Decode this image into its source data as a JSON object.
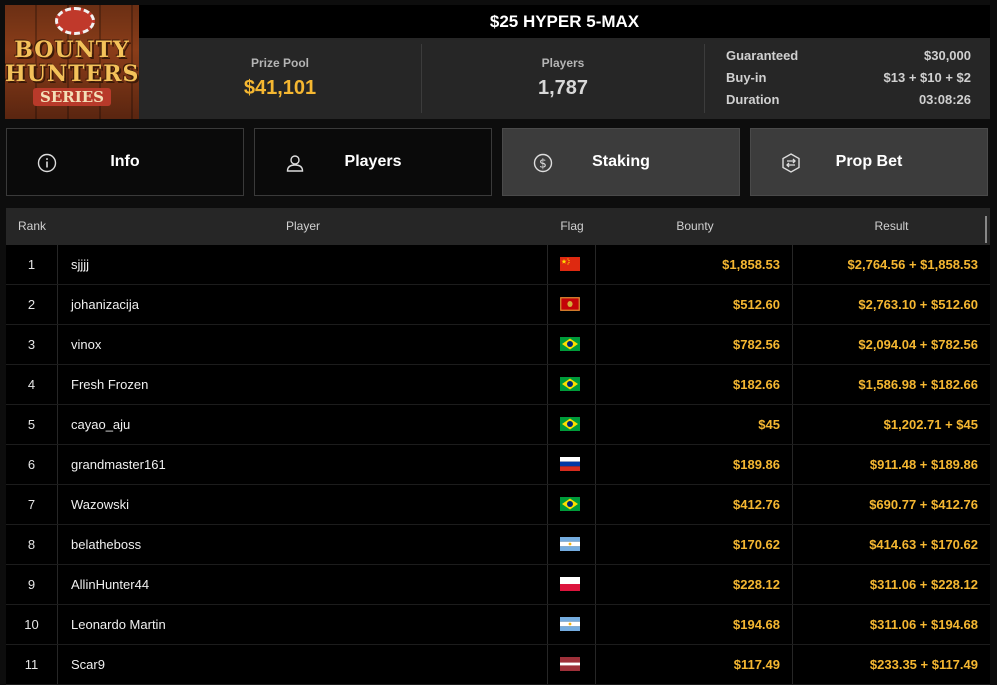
{
  "logo": {
    "line1": "BOUNTY",
    "line2": "HUNTERS",
    "line3": "SERIES"
  },
  "title": "$25 HYPER 5-MAX",
  "stats": {
    "prize_pool_label": "Prize Pool",
    "prize_pool_value": "$41,101",
    "players_label": "Players",
    "players_value": "1,787"
  },
  "details": [
    {
      "label": "Guaranteed",
      "value": "$30,000"
    },
    {
      "label": "Buy-in",
      "value": "$13 + $10 + $2"
    },
    {
      "label": "Duration",
      "value": "03:08:26"
    }
  ],
  "tabs": [
    {
      "label": "Info",
      "icon": "info-icon",
      "active": false
    },
    {
      "label": "Players",
      "icon": "user-icon",
      "active": false
    },
    {
      "label": "Staking",
      "icon": "dollar-coin-icon",
      "active": true
    },
    {
      "label": "Prop Bet",
      "icon": "prop-bet-icon",
      "active": false
    }
  ],
  "table": {
    "headers": {
      "rank": "Rank",
      "player": "Player",
      "flag": "Flag",
      "bounty": "Bounty",
      "result": "Result"
    },
    "rows": [
      {
        "rank": "1",
        "player": "sjjjj",
        "flag": "cn",
        "bounty": "$1,858.53",
        "result": "$2,764.56 + $1,858.53"
      },
      {
        "rank": "2",
        "player": "johanizacija",
        "flag": "me",
        "bounty": "$512.60",
        "result": "$2,763.10 + $512.60"
      },
      {
        "rank": "3",
        "player": "vinox",
        "flag": "br",
        "bounty": "$782.56",
        "result": "$2,094.04 + $782.56"
      },
      {
        "rank": "4",
        "player": "Fresh Frozen",
        "flag": "br",
        "bounty": "$182.66",
        "result": "$1,586.98 + $182.66"
      },
      {
        "rank": "5",
        "player": "cayao_aju",
        "flag": "br",
        "bounty": "$45",
        "result": "$1,202.71 + $45"
      },
      {
        "rank": "6",
        "player": "grandmaster161",
        "flag": "ru",
        "bounty": "$189.86",
        "result": "$911.48 + $189.86"
      },
      {
        "rank": "7",
        "player": "Wazowski",
        "flag": "br",
        "bounty": "$412.76",
        "result": "$690.77 + $412.76"
      },
      {
        "rank": "8",
        "player": "belatheboss",
        "flag": "ar",
        "bounty": "$170.62",
        "result": "$414.63 + $170.62"
      },
      {
        "rank": "9",
        "player": "AllinHunter44",
        "flag": "pl",
        "bounty": "$228.12",
        "result": "$311.06 + $228.12"
      },
      {
        "rank": "10",
        "player": "Leonardo Martin",
        "flag": "ar",
        "bounty": "$194.68",
        "result": "$311.06 + $194.68"
      },
      {
        "rank": "11",
        "player": "Scar9",
        "flag": "lv",
        "bounty": "$117.49",
        "result": "$233.35 + $117.49"
      }
    ]
  },
  "colors": {
    "accent": "#f5b731",
    "active_tab": "#3c3c3c",
    "header_bg": "#262626"
  }
}
